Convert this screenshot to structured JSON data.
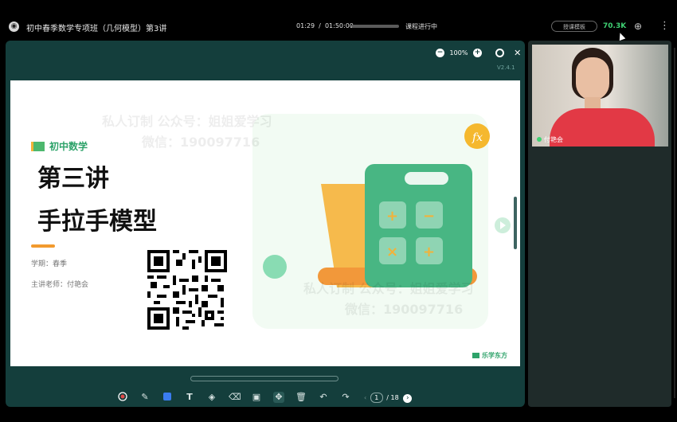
{
  "window": {
    "title": "初中春季数学专项班（几何模型）第3讲",
    "time_current": "01:29",
    "time_total": "01:50:00",
    "progress": 0.01,
    "status": "课程进行中",
    "pill_label": "授课模板",
    "speed": "70.3K"
  },
  "board": {
    "zoom": "100%",
    "version": "V2.4.1"
  },
  "slide": {
    "subject": "初中数学",
    "lecture": "第三讲",
    "topic": "手拉手模型",
    "term": "学期：春季",
    "teacher": "主讲老师：付艳会",
    "brand": "乐学东方",
    "watermark_line1": "私人订制 公众号：姐姐爱学习",
    "watermark_line2": "微信：190097716"
  },
  "pager": {
    "current": "1",
    "total": "/ 18"
  },
  "video": {
    "name": "付艳会"
  },
  "icons": {
    "tools": [
      "record-icon",
      "pen-icon",
      "color-icon",
      "text-icon",
      "highlighter-icon",
      "eraser-icon",
      "save-icon",
      "move-icon",
      "delete-icon",
      "undo-icon",
      "redo-icon"
    ]
  },
  "colors": {
    "board_bg": "#143e3c",
    "accent_green": "#2ea36a",
    "speed_green": "#3fd173",
    "accent_orange": "#f29a2e"
  }
}
